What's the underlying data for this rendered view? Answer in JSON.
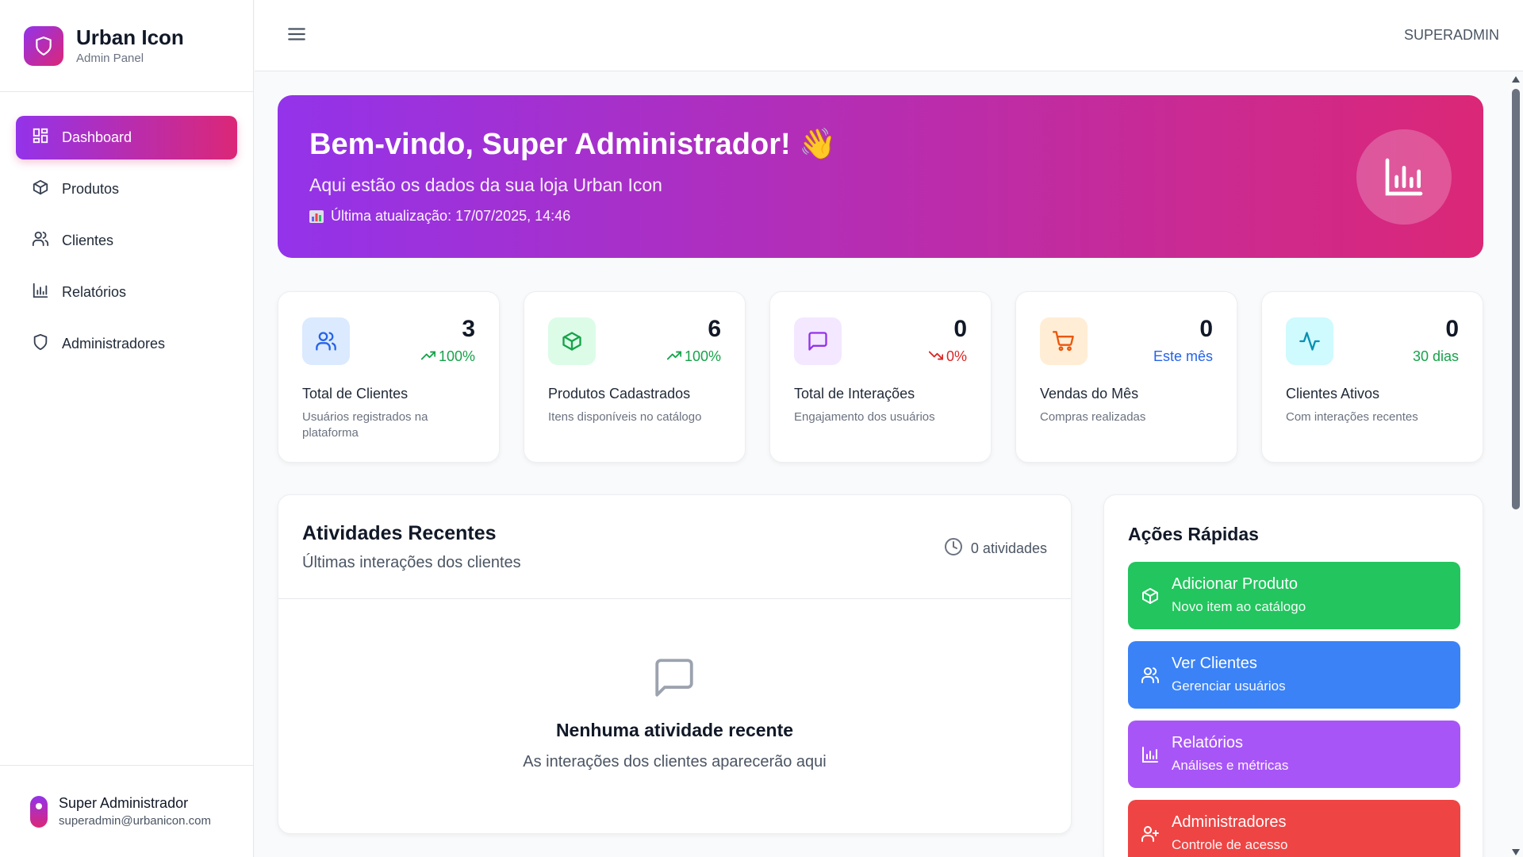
{
  "brand": {
    "title": "Urban Icon",
    "subtitle": "Admin Panel"
  },
  "sidebar": {
    "items": [
      {
        "label": "Dashboard",
        "icon": "dashboard-icon",
        "active": true
      },
      {
        "label": "Produtos",
        "icon": "box-icon"
      },
      {
        "label": "Clientes",
        "icon": "users-icon"
      },
      {
        "label": "Relatórios",
        "icon": "bar-chart-icon"
      },
      {
        "label": "Administradores",
        "icon": "shield-icon"
      }
    ]
  },
  "user": {
    "name": "Super Administrador",
    "email": "superadmin@urbanicon.com"
  },
  "topbar": {
    "role": "SUPERADMIN"
  },
  "banner": {
    "title": "Bem-vindo, Super Administrador! 👋",
    "subtitle": "Aqui estão os dados da sua loja Urban Icon",
    "updated": "Última atualização: 17/07/2025, 14:46"
  },
  "stats": [
    {
      "value": "3",
      "trend": "100%",
      "trend_dir": "up",
      "label": "Total de Clientes",
      "desc": "Usuários registrados na plataforma",
      "color": "#2563eb",
      "bg": "#dbeafe",
      "icon": "users-icon"
    },
    {
      "value": "6",
      "trend": "100%",
      "trend_dir": "up",
      "label": "Produtos Cadastrados",
      "desc": "Itens disponíveis no catálogo",
      "color": "#16a34a",
      "bg": "#dcfce7",
      "icon": "box-icon"
    },
    {
      "value": "0",
      "trend": "0%",
      "trend_dir": "down",
      "label": "Total de Interações",
      "desc": "Engajamento dos usuários",
      "color": "#9333ea",
      "bg": "#f3e8ff",
      "icon": "message-icon"
    },
    {
      "value": "0",
      "trend": "Este mês",
      "label": "Vendas do Mês",
      "desc": "Compras realizadas",
      "color": "#ea580c",
      "bg": "#ffedd5",
      "icon": "cart-icon"
    },
    {
      "value": "0",
      "trend": "30 dias",
      "label": "Clientes Ativos",
      "desc": "Com interações recentes",
      "color": "#0891b2",
      "bg": "#cffafe",
      "icon": "activity-icon"
    }
  ],
  "activities": {
    "title": "Atividades Recentes",
    "subtitle": "Últimas interações dos clientes",
    "count": "0 atividades",
    "empty_title": "Nenhuma atividade recente",
    "empty_text": "As interações dos clientes aparecerão aqui"
  },
  "quick_actions": {
    "title": "Ações Rápidas",
    "items": [
      {
        "title": "Adicionar Produto",
        "subtitle": "Novo item ao catálogo",
        "color": "#22c55e",
        "icon": "box-icon"
      },
      {
        "title": "Ver Clientes",
        "subtitle": "Gerenciar usuários",
        "color": "#3b82f6",
        "icon": "users-icon"
      },
      {
        "title": "Relatórios",
        "subtitle": "Análises e métricas",
        "color": "#a855f7",
        "icon": "bar-chart-icon"
      },
      {
        "title": "Administradores",
        "subtitle": "Controle de acesso",
        "color": "#ef4444",
        "icon": "user-plus-icon"
      }
    ]
  },
  "colors": {
    "accent_start": "#9333ea",
    "accent_end": "#db2777",
    "trend_up": "#16a34a",
    "trend_down": "#dc2626",
    "trend_neutral_blue": "#2563eb",
    "trend_neutral_green": "#16a34a"
  }
}
